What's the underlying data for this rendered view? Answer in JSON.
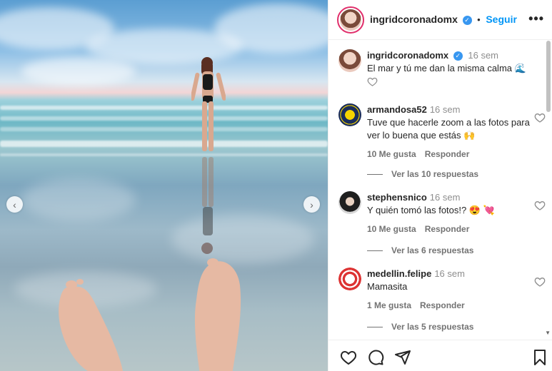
{
  "post": {
    "author": "ingridcoronadomx",
    "follow_label": "Seguir",
    "more_label": "•••",
    "caption_user": "ingridcoronadomx",
    "caption_time": "16 sem",
    "caption_text": "El mar y tú me dan la misma calma 🌊"
  },
  "comments": [
    {
      "user": "armandosa52",
      "time": "16 sem",
      "text": "Tuve que hacerle zoom a las fotos para ver lo buena que estás 🙌",
      "likes": "10 Me gusta",
      "reply": "Responder",
      "replies": "Ver las 10 respuestas"
    },
    {
      "user": "stephensnico",
      "time": "16 sem",
      "text": "Y quién tomó las fotos!? 😍 💘",
      "likes": "10 Me gusta",
      "reply": "Responder",
      "replies": "Ver las 6 respuestas"
    },
    {
      "user": "medellin.felipe",
      "time": "16 sem",
      "text": "Mamasita",
      "likes": "1 Me gusta",
      "reply": "Responder",
      "replies": "Ver las 5 respuestas"
    }
  ],
  "icons": {
    "prev": "chevron-left-icon",
    "next": "chevron-right-icon",
    "like": "heart-icon",
    "comment": "comment-icon",
    "share": "send-icon",
    "save": "bookmark-icon"
  },
  "colors": {
    "accent": "#0095f6",
    "verified": "#3897f0"
  }
}
